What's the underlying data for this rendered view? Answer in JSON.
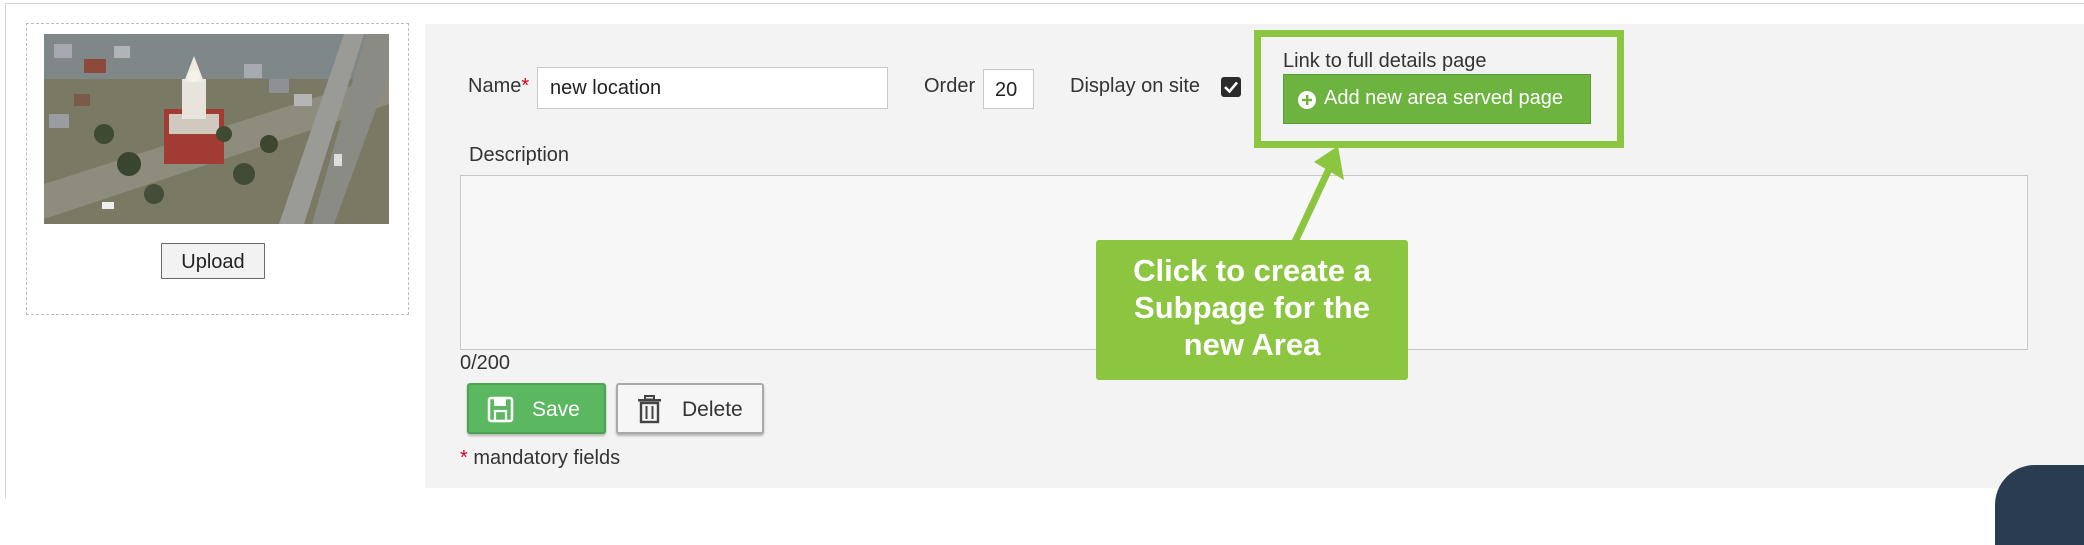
{
  "image_box": {
    "upload_label": "Upload"
  },
  "form": {
    "name_label": "Name",
    "required_marker": "*",
    "name_value": "new location",
    "order_label": "Order",
    "order_value": "20",
    "display_label": "Display on site",
    "display_checked": true,
    "link_label": "Link to full details page",
    "add_page_button_label": "Add new area served page",
    "description_label": "Description",
    "description_value": "",
    "char_count": "0/200",
    "save_label": "Save",
    "delete_label": "Delete",
    "mandatory_note": "mandatory fields"
  },
  "callout": {
    "text_line1": "Click to create a",
    "text_line2": "Subpage for the",
    "text_line3": "new Area"
  },
  "colors": {
    "accent_green": "#8cc540",
    "button_green": "#6db33f",
    "save_green": "#5bb861",
    "required_red": "#d0021b",
    "panel_bg": "#f3f3f3"
  },
  "icons": {
    "add": "plus-circle-icon",
    "save": "floppy-disk-icon",
    "delete": "trash-icon",
    "checkbox": "checkmark-icon"
  }
}
